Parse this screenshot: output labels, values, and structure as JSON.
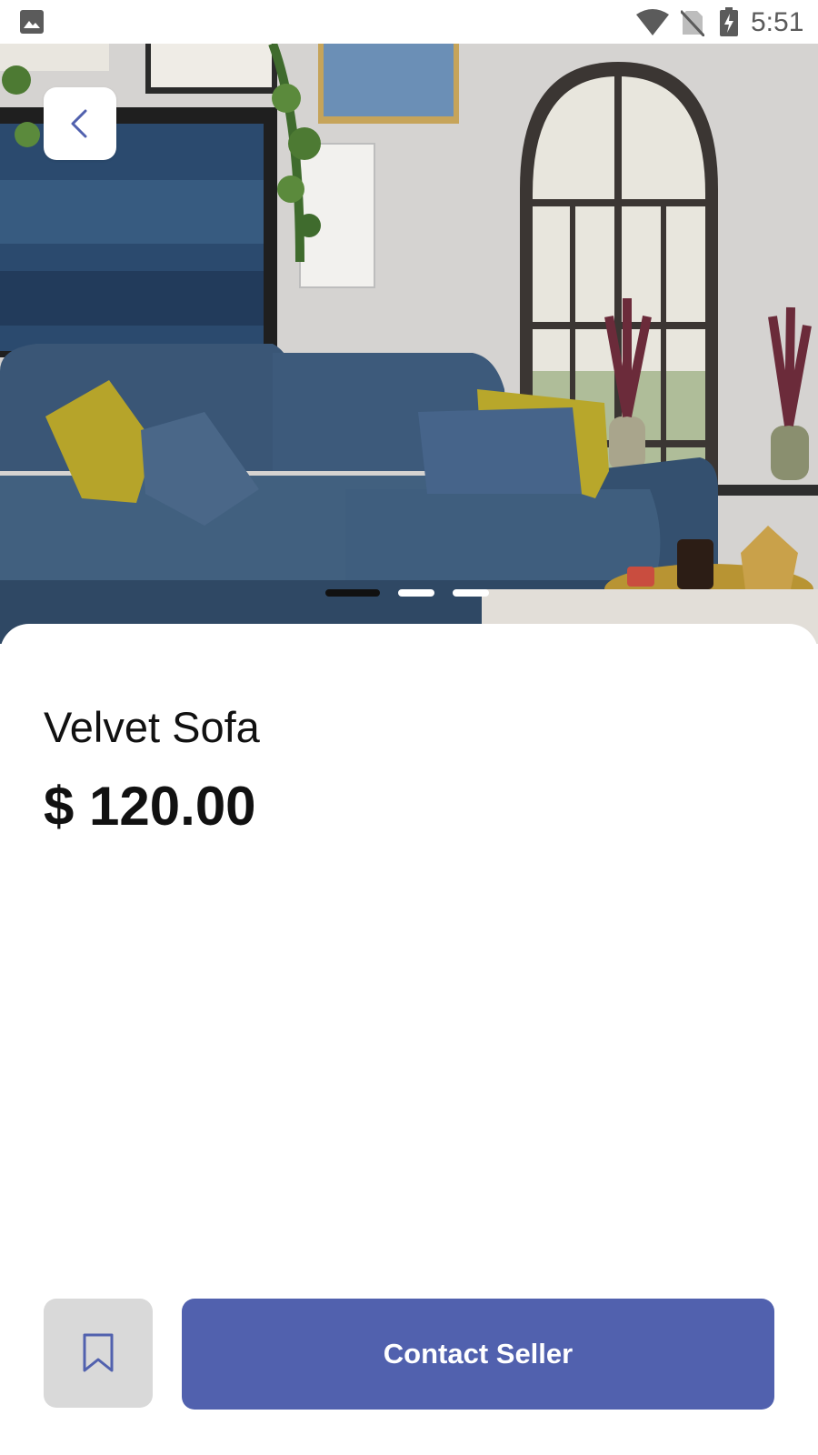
{
  "status_bar": {
    "time": "5:51",
    "icons": [
      "gallery-icon",
      "wifi-icon",
      "no-sim-icon",
      "battery-charging-icon"
    ]
  },
  "hero": {
    "image_subject": "blue velvet sofa in living room",
    "back_icon": "chevron-left-icon",
    "carousel": {
      "total": 3,
      "active_index": 0
    }
  },
  "product": {
    "title": "Velvet Sofa",
    "price": "$ 120.00"
  },
  "actions": {
    "bookmark_icon": "bookmark-icon",
    "contact_label": "Contact Seller"
  },
  "colors": {
    "accent": "#5161ae",
    "bookmark_bg": "#d9d9d9",
    "text": "#111111",
    "sofa": "#3b5472",
    "pillow": "#b6a42a"
  }
}
